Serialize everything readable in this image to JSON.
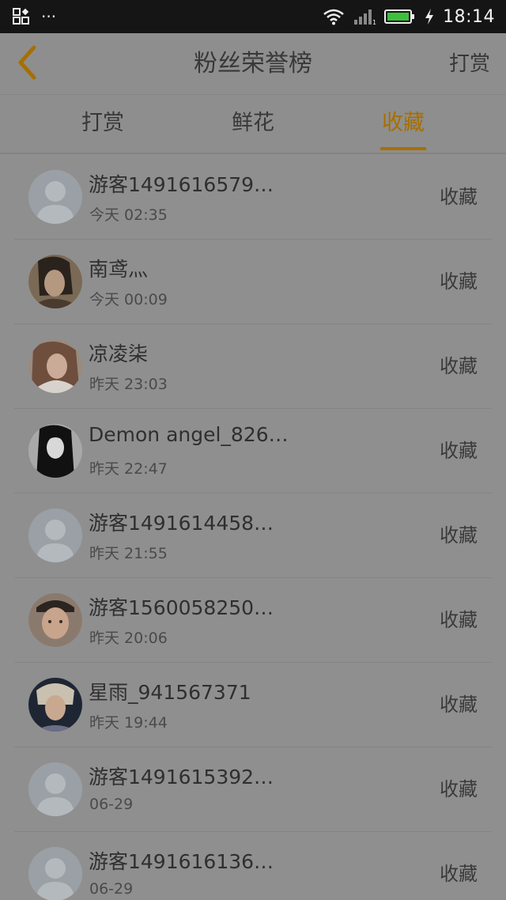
{
  "status_bar": {
    "time": "18:14",
    "left_icons": [
      "app-grid-icon",
      "more-dots-icon"
    ],
    "right_icons": [
      "wifi-icon",
      "signal-icon",
      "battery-icon",
      "charging-icon"
    ],
    "more_dots": "···"
  },
  "header": {
    "title": "粉丝荣誉榜",
    "action_label": "打赏",
    "back_icon": "chevron-left-icon",
    "accent_color": "#a66f00"
  },
  "tabs": [
    {
      "label": "打赏",
      "active": false
    },
    {
      "label": "鲜花",
      "active": false
    },
    {
      "label": "收藏",
      "active": true
    }
  ],
  "list": {
    "items": [
      {
        "name": "游客1491616579…",
        "time": "今天  02:35",
        "action": "收藏",
        "avatar": "default-avatar"
      },
      {
        "name": "南鸢灬",
        "time": "今天  00:09",
        "action": "收藏",
        "avatar": "photo-avatar"
      },
      {
        "name": "凉凌柒",
        "time": "昨天  23:03",
        "action": "收藏",
        "avatar": "photo-avatar"
      },
      {
        "name": "Demon  angel_826…",
        "time": "昨天  22:47",
        "action": "收藏",
        "avatar": "anime-avatar"
      },
      {
        "name": "游客1491614458…",
        "time": "昨天  21:55",
        "action": "收藏",
        "avatar": "default-avatar"
      },
      {
        "name": "游客1560058250…",
        "time": "昨天  20:06",
        "action": "收藏",
        "avatar": "photo-avatar"
      },
      {
        "name": "星雨_941567371",
        "time": "昨天  19:44",
        "action": "收藏",
        "avatar": "photo-avatar"
      },
      {
        "name": "游客1491615392…",
        "time": "06-29",
        "action": "收藏",
        "avatar": "default-avatar"
      },
      {
        "name": "游客1491616136…",
        "time": "06-29",
        "action": "收藏",
        "avatar": "default-avatar"
      }
    ]
  }
}
